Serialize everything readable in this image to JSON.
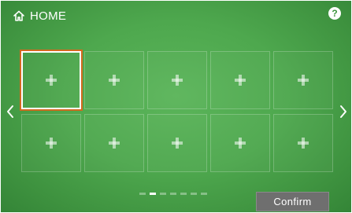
{
  "header": {
    "title": "HOME",
    "icon": "home-icon"
  },
  "help": {
    "label": "?"
  },
  "grid": {
    "tiles": [
      {
        "icon": "plus-icon",
        "selected": true
      },
      {
        "icon": "plus-icon",
        "selected": false
      },
      {
        "icon": "plus-icon",
        "selected": false
      },
      {
        "icon": "plus-icon",
        "selected": false
      },
      {
        "icon": "plus-icon",
        "selected": false
      },
      {
        "icon": "plus-icon",
        "selected": false
      },
      {
        "icon": "plus-icon",
        "selected": false
      },
      {
        "icon": "plus-icon",
        "selected": false
      },
      {
        "icon": "plus-icon",
        "selected": false
      },
      {
        "icon": "plus-icon",
        "selected": false
      }
    ]
  },
  "navigation": {
    "left_icon": "chevron-left-icon",
    "right_icon": "chevron-right-icon"
  },
  "pager": {
    "total_pages": 7,
    "current_page": 2
  },
  "actions": {
    "confirm_label": "Confirm"
  },
  "colors": {
    "background": "#4ea84e",
    "selection_border": "#d2691e",
    "button_background": "#6f6f6f"
  }
}
